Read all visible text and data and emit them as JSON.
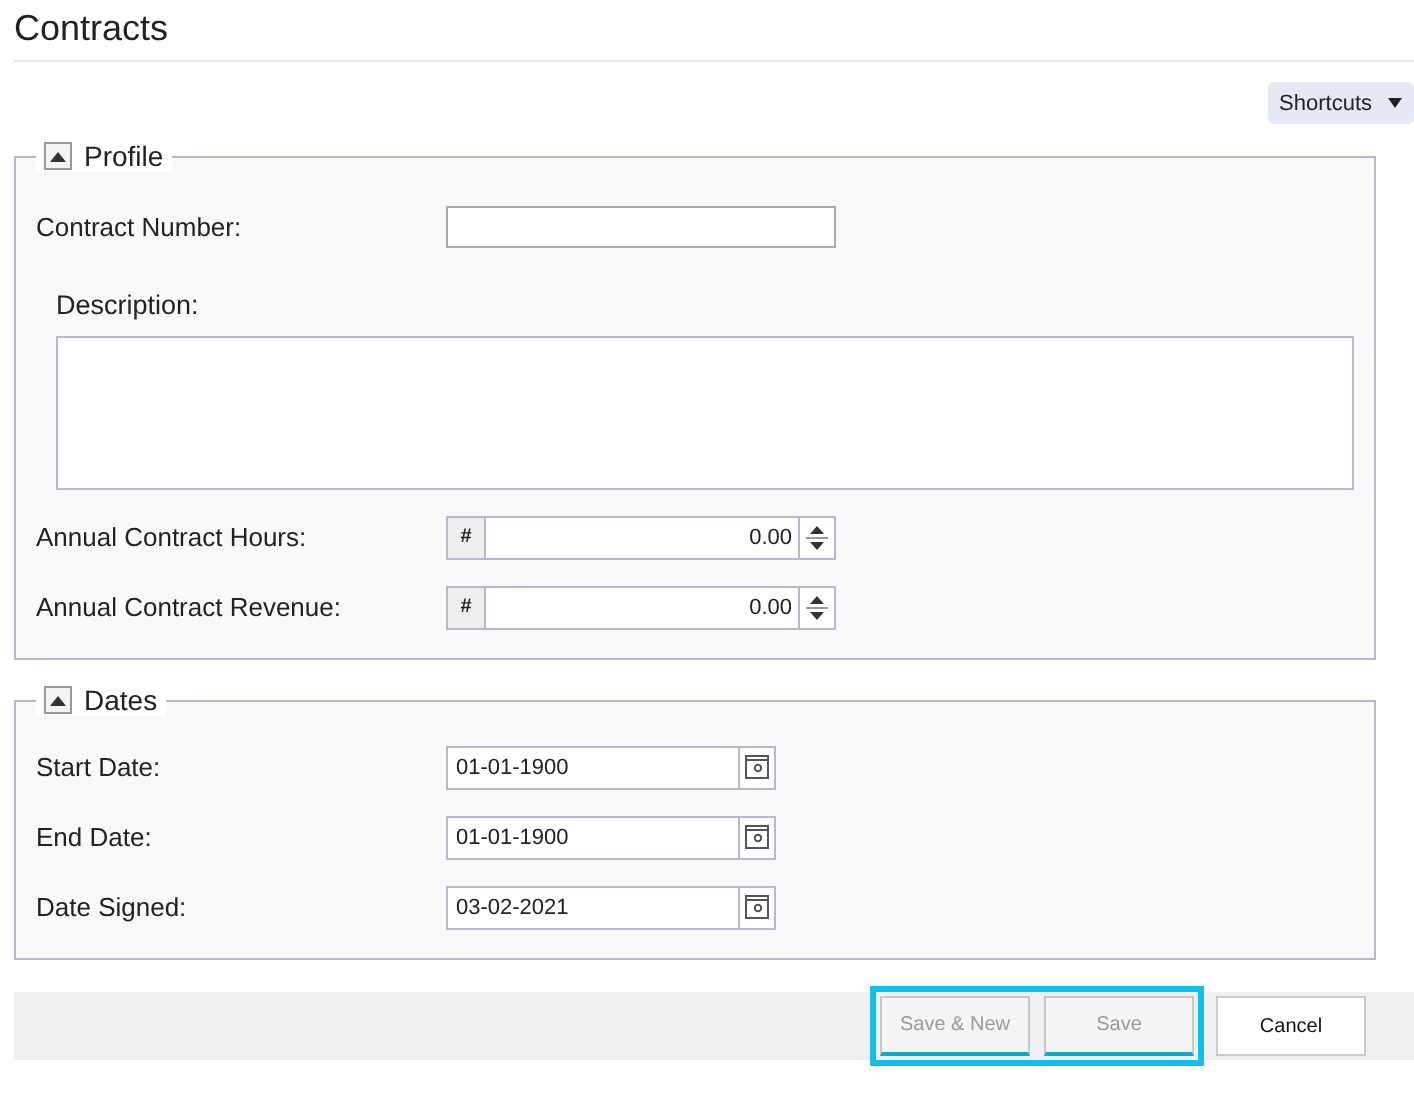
{
  "title": "Contracts",
  "shortcuts": {
    "label": "Shortcuts"
  },
  "sections": [
    {
      "title": "Profile",
      "expanded": true,
      "fields": [
        {
          "kind": "text",
          "label": "Contract Number:"
        },
        {
          "kind": "textarea",
          "label": "Description:"
        },
        {
          "kind": "number",
          "label": "Annual Contract Hours:",
          "prefix": "#",
          "value": "0.00"
        },
        {
          "kind": "number",
          "label": "Annual Contract Revenue:",
          "prefix": "#",
          "value": "0.00"
        }
      ]
    },
    {
      "title": "Dates",
      "expanded": true,
      "fields": [
        {
          "kind": "date",
          "label": "Start Date:",
          "value": "01-01-1900"
        },
        {
          "kind": "date",
          "label": "End Date:",
          "value": "01-01-1900"
        },
        {
          "kind": "date",
          "label": "Date Signed:",
          "value": "03-02-2021"
        }
      ]
    }
  ],
  "buttons": [
    {
      "label": "Save & New",
      "disabled": true,
      "highlighted": true
    },
    {
      "label": "Save",
      "disabled": true,
      "highlighted": true
    },
    {
      "label": "Cancel",
      "disabled": false,
      "highlighted": false
    }
  ]
}
